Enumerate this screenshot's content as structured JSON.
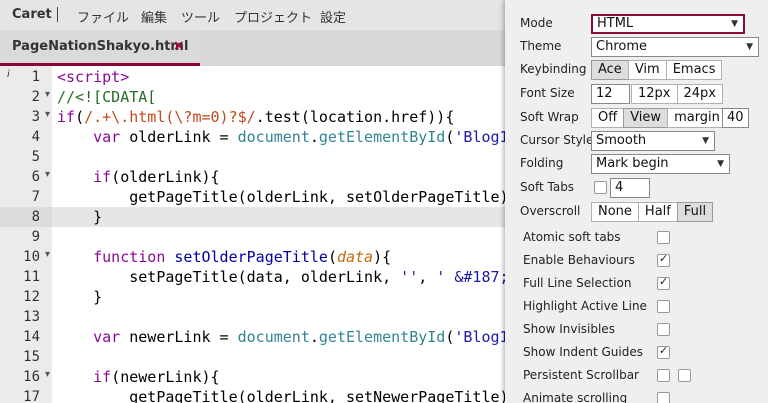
{
  "menubar": {
    "app": "Caret",
    "items": [
      "ファイル",
      "編集",
      "ツール",
      "プロジェクト",
      "設定"
    ]
  },
  "tab": {
    "title": "PageNationShakyo.html",
    "close": "×"
  },
  "gutter": {
    "info_marker": "i",
    "active_line": 8
  },
  "editor": {
    "line_numbers": [
      "1",
      "2",
      "3",
      "4",
      "5",
      "6",
      "7",
      "8",
      "9",
      "10",
      "11",
      "12",
      "13",
      "14",
      "15",
      "16",
      "17"
    ],
    "lines": [
      [
        {
          "t": "<script>",
          "c": "t"
        }
      ],
      [
        {
          "t": "//<![CDATA[",
          "c": "cm"
        }
      ],
      [
        {
          "t": "if",
          "c": "k"
        },
        {
          "t": "(",
          "c": "punc"
        },
        {
          "t": "/.+\\.html(\\?m=0)?$/",
          "c": "re"
        },
        {
          "t": ".test(location.href)){",
          "c": "punc"
        }
      ],
      [
        {
          "t": "    ",
          "c": "punc"
        },
        {
          "t": "var",
          "c": "k"
        },
        {
          "t": " olderLink = ",
          "c": "punc"
        },
        {
          "t": "document",
          "c": "id"
        },
        {
          "t": ".",
          "c": "punc"
        },
        {
          "t": "getElementById",
          "c": "id"
        },
        {
          "t": "(",
          "c": "punc"
        },
        {
          "t": "'Blog1",
          "c": "str"
        }
      ],
      [],
      [
        {
          "t": "    ",
          "c": "punc"
        },
        {
          "t": "if",
          "c": "k"
        },
        {
          "t": "(olderLink){",
          "c": "punc"
        }
      ],
      [
        {
          "t": "        getPageTitle(olderLink, setOlderPageTitle)",
          "c": "punc"
        }
      ],
      [
        {
          "t": "    }",
          "c": "punc"
        }
      ],
      [],
      [
        {
          "t": "    ",
          "c": "punc"
        },
        {
          "t": "function",
          "c": "k"
        },
        {
          "t": " ",
          "c": "punc"
        },
        {
          "t": "setOlderPageTitle",
          "c": "fn"
        },
        {
          "t": "(",
          "c": "punc"
        },
        {
          "t": "data",
          "c": "par"
        },
        {
          "t": "){",
          "c": "punc"
        }
      ],
      [
        {
          "t": "        setPageTitle(data, olderLink, ",
          "c": "punc"
        },
        {
          "t": "''",
          "c": "str"
        },
        {
          "t": ", ",
          "c": "punc"
        },
        {
          "t": "' &#187;",
          "c": "str"
        }
      ],
      [
        {
          "t": "    }",
          "c": "punc"
        }
      ],
      [],
      [
        {
          "t": "    ",
          "c": "punc"
        },
        {
          "t": "var",
          "c": "k"
        },
        {
          "t": " newerLink = ",
          "c": "punc"
        },
        {
          "t": "document",
          "c": "id"
        },
        {
          "t": ".",
          "c": "punc"
        },
        {
          "t": "getElementById",
          "c": "id"
        },
        {
          "t": "(",
          "c": "punc"
        },
        {
          "t": "'Blog1",
          "c": "str"
        }
      ],
      [],
      [
        {
          "t": "    ",
          "c": "punc"
        },
        {
          "t": "if",
          "c": "k"
        },
        {
          "t": "(newerLink){",
          "c": "punc"
        }
      ],
      [
        {
          "t": "        getPageTitle(olderLink, setNewerPageTitle)",
          "c": "punc"
        }
      ]
    ],
    "fold_lines": [
      2,
      3,
      6,
      10,
      16
    ]
  },
  "settings": {
    "mode": {
      "label": "Mode",
      "value": "HTML"
    },
    "theme": {
      "label": "Theme",
      "value": "Chrome"
    },
    "keybinding": {
      "label": "Keybinding",
      "options": [
        "Ace",
        "Vim",
        "Emacs"
      ],
      "selected": "Ace"
    },
    "font_size": {
      "label": "Font Size",
      "value": "12",
      "options": [
        "12px",
        "24px"
      ]
    },
    "soft_wrap": {
      "label": "Soft Wrap",
      "options": [
        "Off",
        "View",
        "margin"
      ],
      "selected": "View",
      "value": "40"
    },
    "cursor_style": {
      "label": "Cursor Style",
      "value": "Smooth"
    },
    "folding": {
      "label": "Folding",
      "value": "Mark begin"
    },
    "soft_tabs": {
      "label": "Soft Tabs",
      "value": "4",
      "checked": false
    },
    "overscroll": {
      "label": "Overscroll",
      "options": [
        "None",
        "Half",
        "Full"
      ],
      "selected": "Full"
    },
    "checkboxes": [
      {
        "label": "Atomic soft tabs",
        "checked": false
      },
      {
        "label": "Enable Behaviours",
        "checked": true
      },
      {
        "label": "Full Line Selection",
        "checked": true
      },
      {
        "label": "Highlight Active Line",
        "checked": false
      },
      {
        "label": "Show Invisibles",
        "checked": false
      },
      {
        "label": "Show Indent Guides",
        "checked": true
      },
      {
        "label": "Persistent Scrollbar",
        "checked": false,
        "second_checked": false
      },
      {
        "label": "Animate scrolling",
        "checked": false
      }
    ]
  }
}
